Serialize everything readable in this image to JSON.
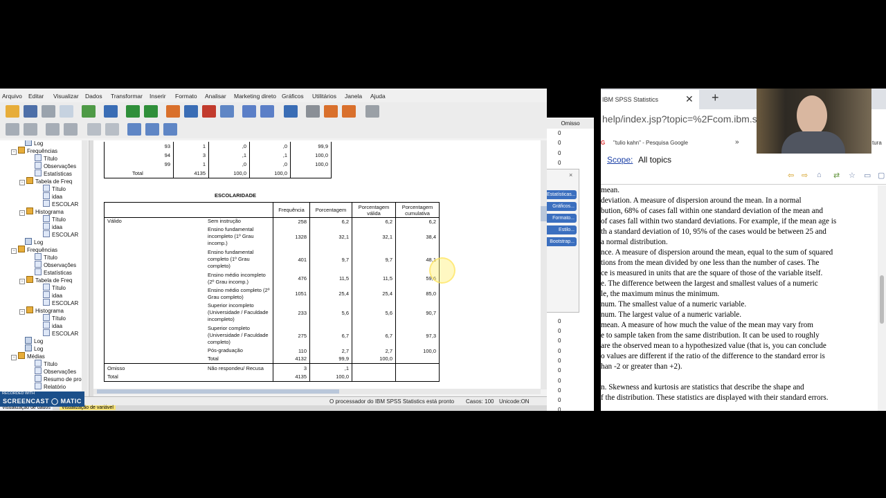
{
  "menu": [
    "Arquivo",
    "Editar",
    "Visualizar",
    "Dados",
    "Transformar",
    "Inserir",
    "Formato",
    "Analisar",
    "Marketing direto",
    "Gráficos",
    "Utilitários",
    "Janela",
    "Ajuda"
  ],
  "outline": {
    "items": [
      {
        "label": "Log",
        "icon": "log"
      },
      {
        "label": "Frequências",
        "icon": "book"
      },
      {
        "label": "Título",
        "icon": "doc"
      },
      {
        "label": "Observações",
        "icon": "doc"
      },
      {
        "label": "Estatísticas",
        "icon": "doc"
      },
      {
        "label": "Tabela de Freq",
        "icon": "book"
      },
      {
        "label": "Título",
        "icon": "doc"
      },
      {
        "label": "idaa",
        "icon": "doc"
      },
      {
        "label": "ESCOLAR",
        "icon": "doc"
      },
      {
        "label": "Histograma",
        "icon": "book"
      },
      {
        "label": "Título",
        "icon": "doc"
      },
      {
        "label": "idaa",
        "icon": "doc"
      },
      {
        "label": "ESCOLAR",
        "icon": "doc"
      },
      {
        "label": "Log",
        "icon": "log"
      },
      {
        "label": "Frequências",
        "icon": "book"
      },
      {
        "label": "Título",
        "icon": "doc"
      },
      {
        "label": "Observações",
        "icon": "doc"
      },
      {
        "label": "Estatísticas",
        "icon": "doc"
      },
      {
        "label": "Tabela de Freq",
        "icon": "book"
      },
      {
        "label": "Título",
        "icon": "doc"
      },
      {
        "label": "idaa",
        "icon": "doc"
      },
      {
        "label": "ESCOLAR",
        "icon": "doc"
      },
      {
        "label": "Histograma",
        "icon": "book"
      },
      {
        "label": "Título",
        "icon": "doc"
      },
      {
        "label": "idaa",
        "icon": "doc"
      },
      {
        "label": "ESCOLAR",
        "icon": "doc"
      },
      {
        "label": "Log",
        "icon": "log"
      },
      {
        "label": "Log",
        "icon": "log"
      },
      {
        "label": "Médias",
        "icon": "book"
      },
      {
        "label": "Título",
        "icon": "doc"
      },
      {
        "label": "Observações",
        "icon": "doc"
      },
      {
        "label": "Resumo de pro",
        "icon": "doc"
      },
      {
        "label": "Relatório",
        "icon": "doc"
      }
    ]
  },
  "top_table": {
    "rows": [
      [
        "93",
        "1",
        ",0",
        ",0",
        "99,9"
      ],
      [
        "94",
        "3",
        ",1",
        ",1",
        "100,0"
      ],
      [
        "99",
        "1",
        ",0",
        ",0",
        "100,0"
      ],
      [
        "Total",
        "4135",
        "100,0",
        "100,0",
        ""
      ]
    ]
  },
  "escolaridade": {
    "title": "ESCOLARIDADE",
    "headers": [
      "Frequência",
      "Porcentagem",
      "Porcentagem válida",
      "Porcentagem cumulativa"
    ],
    "group_valid": "Válido",
    "group_missing": "Omisso",
    "total_label": "Total",
    "rows": [
      {
        "label": "Sem instrução",
        "f": "258",
        "p": "6,2",
        "pv": "6,2",
        "pc": "6,2"
      },
      {
        "label": "Ensino fundamental incompleto (1º Grau incomp.)",
        "f": "1328",
        "p": "32,1",
        "pv": "32,1",
        "pc": "38,4"
      },
      {
        "label": "Ensino fundamental completo (1º Grau completo)",
        "f": "401",
        "p": "9,7",
        "pv": "9,7",
        "pc": "48,1"
      },
      {
        "label": "Ensino médio incompleto (2º Grau incomp.)",
        "f": "476",
        "p": "11,5",
        "pv": "11,5",
        "pc": "59,6"
      },
      {
        "label": "Ensino médio completo (2º Grau completo)",
        "f": "1051",
        "p": "25,4",
        "pv": "25,4",
        "pc": "85,0"
      },
      {
        "label": "Superior incompleto (Universidade / Faculdade incompleto)",
        "f": "233",
        "p": "5,6",
        "pv": "5,6",
        "pc": "90,7"
      },
      {
        "label": "Superior completo (Universidade / Faculdade completo)",
        "f": "275",
        "p": "6,7",
        "pv": "6,7",
        "pc": "97,3"
      },
      {
        "label": "Pós-graduação",
        "f": "110",
        "p": "2,7",
        "pv": "2,7",
        "pc": "100,0"
      },
      {
        "label": "Total",
        "f": "4132",
        "p": "99,9",
        "pv": "100,0",
        "pc": ""
      }
    ],
    "missing": {
      "label": "Não respondeu/ Recusa",
      "f": "3",
      "p": ",1"
    },
    "grand_total": {
      "f": "4135",
      "p": "100,0"
    }
  },
  "status": {
    "processor": "O processador do IBM SPSS Statistics  está pronto",
    "cases": "Casos: 100",
    "unicode": "Unicode:ON"
  },
  "bottom_tabs": [
    "Visualização de dados",
    "Visualização de variável"
  ],
  "watermark": {
    "small": "RECORDED WITH",
    "big": "SCREENCAST ◯ MATIC"
  },
  "grid": {
    "header": "Omisso",
    "values": [
      "0",
      "0",
      "0",
      "0",
      "0",
      "0",
      "0",
      "0",
      "0",
      "0",
      "0",
      "0",
      "0",
      "0",
      "0",
      "0",
      "0",
      "0",
      "0",
      "0",
      "0",
      "0",
      "0",
      "0",
      "0",
      "0",
      "0",
      "0",
      "0"
    ]
  },
  "dialog_buttons": [
    "Estatísticas...",
    "Gráficos...",
    "Formato...",
    "Estilo...",
    "Bootstrap..."
  ],
  "browser": {
    "tab_title": "IBM SPSS Statistics",
    "url": "help/index.jsp?topic=%2Fcom.ibm.s",
    "bookmark": "\"tulio kahn\" - Pesquisa Google",
    "bookmark_more": "»",
    "bookmark_right": "tura",
    "scope_label": "Scope:",
    "scope_value": "All topics",
    "lines": [
      "mean.",
      "deviation. A measure of dispersion around the mean. In a normal",
      "bution, 68% of cases fall within one standard deviation of the mean and",
      "of cases fall within two standard deviations. For example, if the mean age is",
      "th a standard deviation of 10, 95% of the cases would be between 25 and",
      "a normal distribution.",
      "nce. A measure of dispersion around the mean, equal to the sum of squared",
      "tions from the mean divided by one less than the number of cases. The",
      "ce is measured in units that are the square of those of the variable itself.",
      "e. The difference between the largest and smallest values of a numeric",
      "le, the maximum minus the minimum.",
      "num. The smallest value of a numeric variable.",
      "num. The largest value of a numeric variable.",
      "mean. A measure of how much the value of the mean may vary from",
      "e to sample taken from the same distribution. It can be used to roughly",
      "are the observed mean to a hypothesized value (that is, you can conclude",
      "o values are different if the ratio of the difference to the standard error is",
      "han -2 or greater than +2).",
      "",
      "n. Skewness and kurtosis are statistics that describe the shape and",
      "f the distribution. These statistics are displayed with their standard errors."
    ]
  }
}
